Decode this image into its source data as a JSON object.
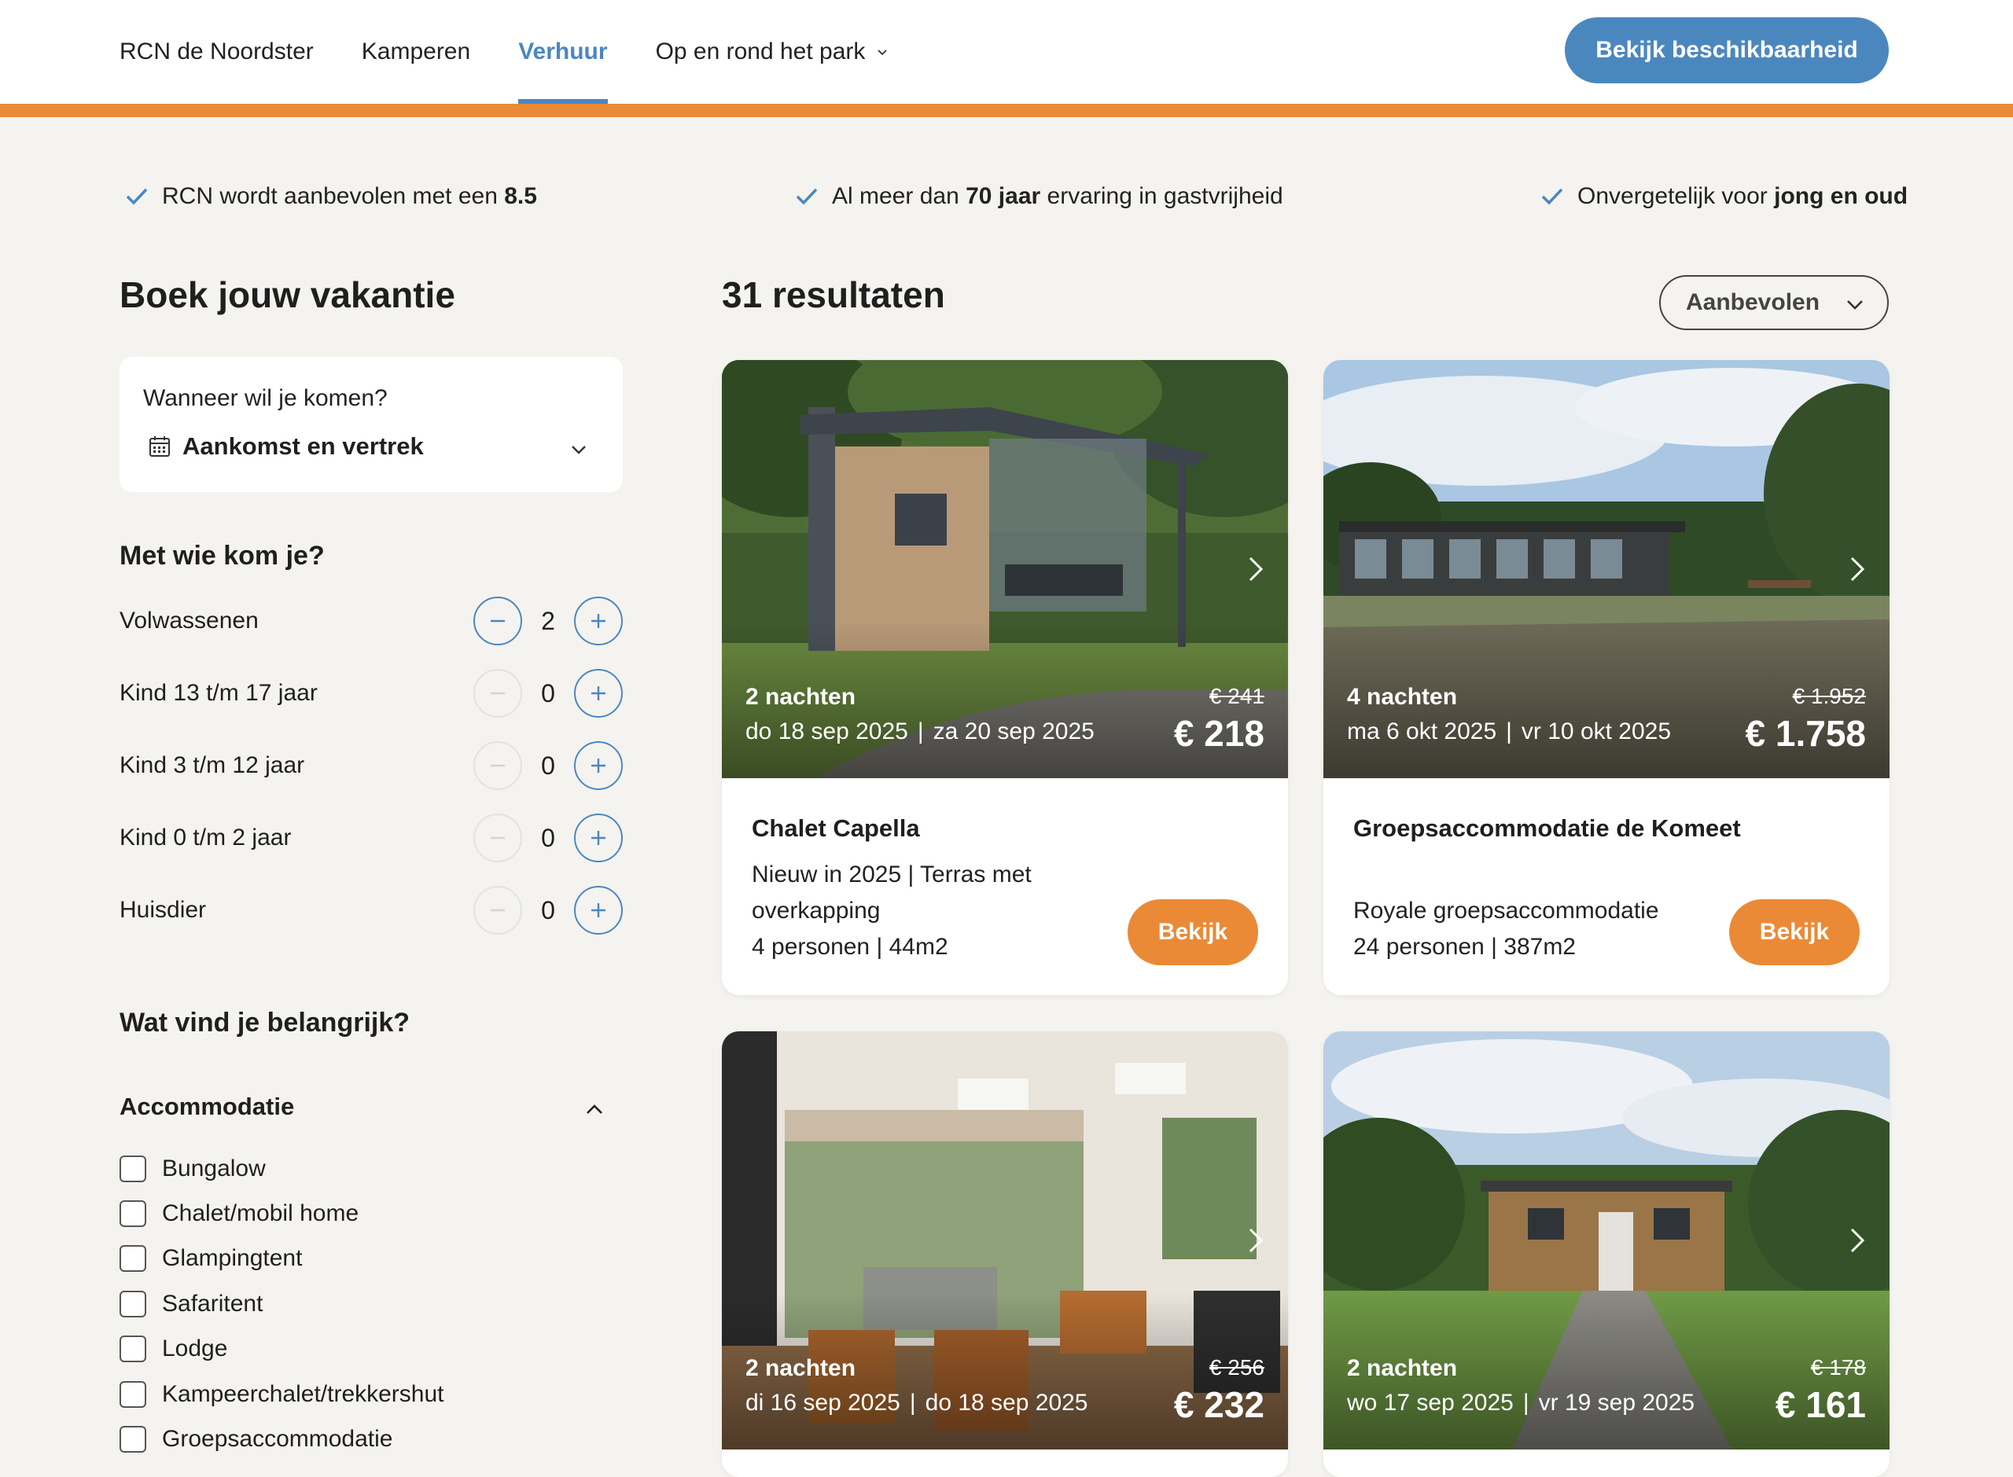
{
  "nav": {
    "items": [
      {
        "label": "RCN de Noordster"
      },
      {
        "label": "Kamperen"
      },
      {
        "label": "Verhuur"
      },
      {
        "label": "Op en rond het park"
      }
    ],
    "active_index": 2,
    "cta": "Bekijk beschikbaarheid"
  },
  "colors": {
    "primary": "#4b87bf",
    "accent": "#ea8a36",
    "background": "#f4f3ef"
  },
  "usps": [
    {
      "pre": "RCN wordt aanbevolen met een ",
      "bold": "8.5",
      "post": ""
    },
    {
      "pre": "Al meer dan ",
      "bold": "70 jaar",
      "post": " ervaring in gastvrijheid"
    },
    {
      "pre": "Onvergetelijk voor ",
      "bold": "jong en oud",
      "post": ""
    }
  ],
  "sidebar": {
    "title": "Boek jouw vakantie",
    "date_question": "Wanneer wil je komen?",
    "date_value": "Aankomst en vertrek",
    "guests_title": "Met wie kom je?",
    "guests": [
      {
        "label": "Volwassenen",
        "value": "2",
        "minus_enabled": true
      },
      {
        "label": "Kind 13 t/m 17 jaar",
        "value": "0",
        "minus_enabled": false
      },
      {
        "label": "Kind 3 t/m 12 jaar",
        "value": "0",
        "minus_enabled": false
      },
      {
        "label": "Kind 0 t/m 2 jaar",
        "value": "0",
        "minus_enabled": false
      },
      {
        "label": "Huisdier",
        "value": "0",
        "minus_enabled": false
      }
    ],
    "important_title": "Wat vind je belangrijk?",
    "accommodation_title": "Accommodatie",
    "accommodation_options": [
      "Bungalow",
      "Chalet/mobil home",
      "Glampingtent",
      "Safaritent",
      "Lodge",
      "Kampeerchalet/trekkershut",
      "Groepsaccommodatie"
    ]
  },
  "results": {
    "title": "31 resultaten",
    "sort_value": "Aanbevolen",
    "cards": [
      {
        "nights": "2 nachten",
        "date_from": "do 18 sep 2025",
        "date_to": "za 20 sep 2025",
        "old_price": "€ 241",
        "price": "€ 218",
        "name": "Chalet Capella",
        "desc": [
          "Nieuw in 2025 | Terras met overkapping",
          "4 personen | 44m2"
        ],
        "button": "Bekijk",
        "image": "chalet-exterior"
      },
      {
        "nights": "4 nachten",
        "date_from": "ma 6 okt 2025",
        "date_to": "vr 10 okt 2025",
        "old_price": "€ 1.952",
        "price": "€ 1.758",
        "name": "Groepsaccommodatie de Komeet",
        "desc": [
          "Royale groepsaccommodatie",
          "24 personen | 387m2"
        ],
        "button": "Bekijk",
        "image": "group-building"
      },
      {
        "nights": "2 nachten",
        "date_from": "di 16 sep 2025",
        "date_to": "do 18 sep 2025",
        "old_price": "€ 256",
        "price": "€ 232",
        "image": "living-room"
      },
      {
        "nights": "2 nachten",
        "date_from": "wo 17 sep 2025",
        "date_to": "vr 19 sep 2025",
        "old_price": "€ 178",
        "price": "€ 161",
        "image": "wooden-chalet"
      }
    ]
  }
}
